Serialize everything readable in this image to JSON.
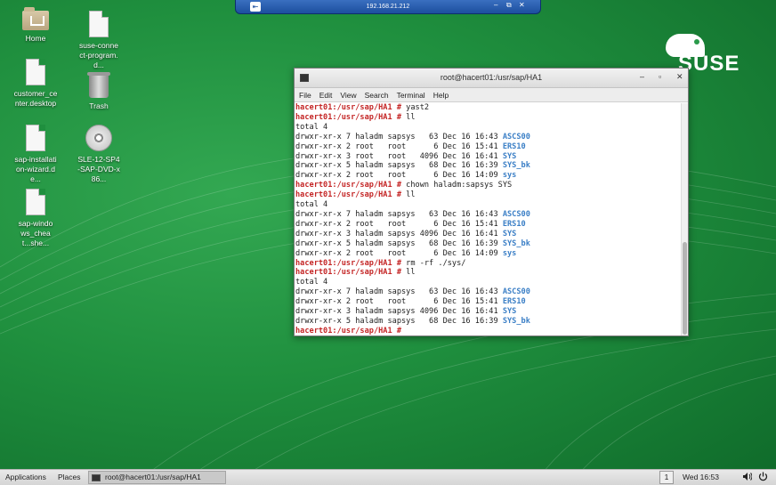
{
  "remote_bar": {
    "title": "192.168.21.212",
    "pin_icon": "pin-icon",
    "controls": [
      "minimize",
      "restore",
      "close"
    ]
  },
  "desktop_icons": [
    {
      "label": "Home",
      "icon": "folder-home-icon"
    },
    {
      "label": "suse-connect-program.d...",
      "icon": "document-icon"
    },
    {
      "label": "customer_center.desktop",
      "icon": "document-icon"
    },
    {
      "label": "Trash",
      "icon": "trash-icon"
    },
    {
      "label": "sap-installation-wizard.de...",
      "icon": "document-icon"
    },
    {
      "label": "SLE-12-SP4-SAP-DVD-x86...",
      "icon": "optical-disc-icon"
    },
    {
      "label": "sap-windows_cheat...she...",
      "icon": "document-icon"
    }
  ],
  "logo": {
    "text": "SUSE"
  },
  "terminal": {
    "title": "root@hacert01:/usr/sap/HA1",
    "menu": [
      "File",
      "Edit",
      "View",
      "Search",
      "Terminal",
      "Help"
    ],
    "lines": [
      {
        "prompt": "hacert01:/usr/sap/HA1 #",
        "cmd": " yast2"
      },
      {
        "prompt": "hacert01:/usr/sap/HA1 #",
        "cmd": " ll"
      },
      {
        "text": "total 4"
      },
      {
        "text": "drwxr-xr-x 7 haladm sapsys   63 Dec 16 16:43 ",
        "dir": "ASCS00"
      },
      {
        "text": "drwxr-xr-x 2 root   root      6 Dec 16 15:41 ",
        "dir": "ERS10"
      },
      {
        "text": "drwxr-xr-x 3 root   root   4096 Dec 16 16:41 ",
        "dir": "SYS"
      },
      {
        "text": "drwxr-xr-x 5 haladm sapsys   68 Dec 16 16:39 ",
        "dir": "SYS_bk"
      },
      {
        "text": "drwxr-xr-x 2 root   root      6 Dec 16 14:09 ",
        "dir": "sys"
      },
      {
        "prompt": "hacert01:/usr/sap/HA1 #",
        "cmd": " chown haladm:sapsys SYS"
      },
      {
        "prompt": "hacert01:/usr/sap/HA1 #",
        "cmd": " ll"
      },
      {
        "text": "total 4"
      },
      {
        "text": "drwxr-xr-x 7 haladm sapsys   63 Dec 16 16:43 ",
        "dir": "ASCS00"
      },
      {
        "text": "drwxr-xr-x 2 root   root      6 Dec 16 15:41 ",
        "dir": "ERS10"
      },
      {
        "text": "drwxr-xr-x 3 haladm sapsys 4096 Dec 16 16:41 ",
        "dir": "SYS"
      },
      {
        "text": "drwxr-xr-x 5 haladm sapsys   68 Dec 16 16:39 ",
        "dir": "SYS_bk"
      },
      {
        "text": "drwxr-xr-x 2 root   root      6 Dec 16 14:09 ",
        "dir": "sys"
      },
      {
        "prompt": "hacert01:/usr/sap/HA1 #",
        "cmd": " rm -rf ./sys/"
      },
      {
        "prompt": "hacert01:/usr/sap/HA1 #",
        "cmd": " ll"
      },
      {
        "text": "total 4"
      },
      {
        "text": "drwxr-xr-x 7 haladm sapsys   63 Dec 16 16:43 ",
        "dir": "ASCS00"
      },
      {
        "text": "drwxr-xr-x 2 root   root      6 Dec 16 15:41 ",
        "dir": "ERS10"
      },
      {
        "text": "drwxr-xr-x 3 haladm sapsys 4096 Dec 16 16:41 ",
        "dir": "SYS"
      },
      {
        "text": "drwxr-xr-x 5 haladm sapsys   68 Dec 16 16:39 ",
        "dir": "SYS_bk"
      },
      {
        "prompt": "hacert01:/usr/sap/HA1 #",
        "cmd": " "
      }
    ]
  },
  "taskbar": {
    "applications": "Applications",
    "places": "Places",
    "task": "root@hacert01:/usr/sap/HA1",
    "workspace": "1",
    "clock": "Wed 16:53",
    "volume_icon": "volume-icon",
    "power_icon": "power-icon"
  },
  "colors": {
    "prompt": "#c42626",
    "directory": "#3b7fc6",
    "desktop_green": "#1f8f3e"
  }
}
